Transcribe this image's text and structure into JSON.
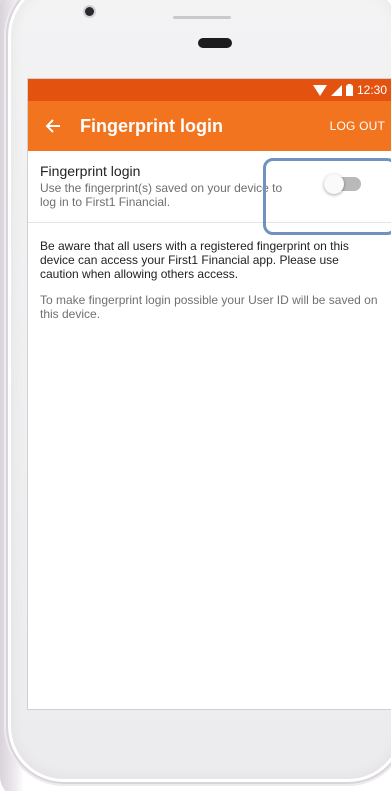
{
  "status_bar": {
    "time": "12:30",
    "wifi_icon": "wifi-icon",
    "signal_icon": "signal-icon",
    "battery_icon": "battery-icon"
  },
  "app_bar": {
    "back_icon": "arrow-back-icon",
    "title": "Fingerprint login",
    "logout_label": "LOG OUT"
  },
  "setting": {
    "title": "Fingerprint login",
    "description": "Use the fingerprint(s) saved on your device to log in to First1 Financial.",
    "toggle_on": false
  },
  "info": {
    "warning": "Be aware that all users with a registered fingerprint on this device can access your First1 Financial app. Please use caution when allowing others access.",
    "note": "To make fingerprint login possible your User ID will be saved on this device."
  },
  "colors": {
    "status_bar": "#e3530f",
    "app_bar": "#f2741f",
    "highlight": "#6f92be",
    "toggle_off_track": "#b9b9b9"
  }
}
